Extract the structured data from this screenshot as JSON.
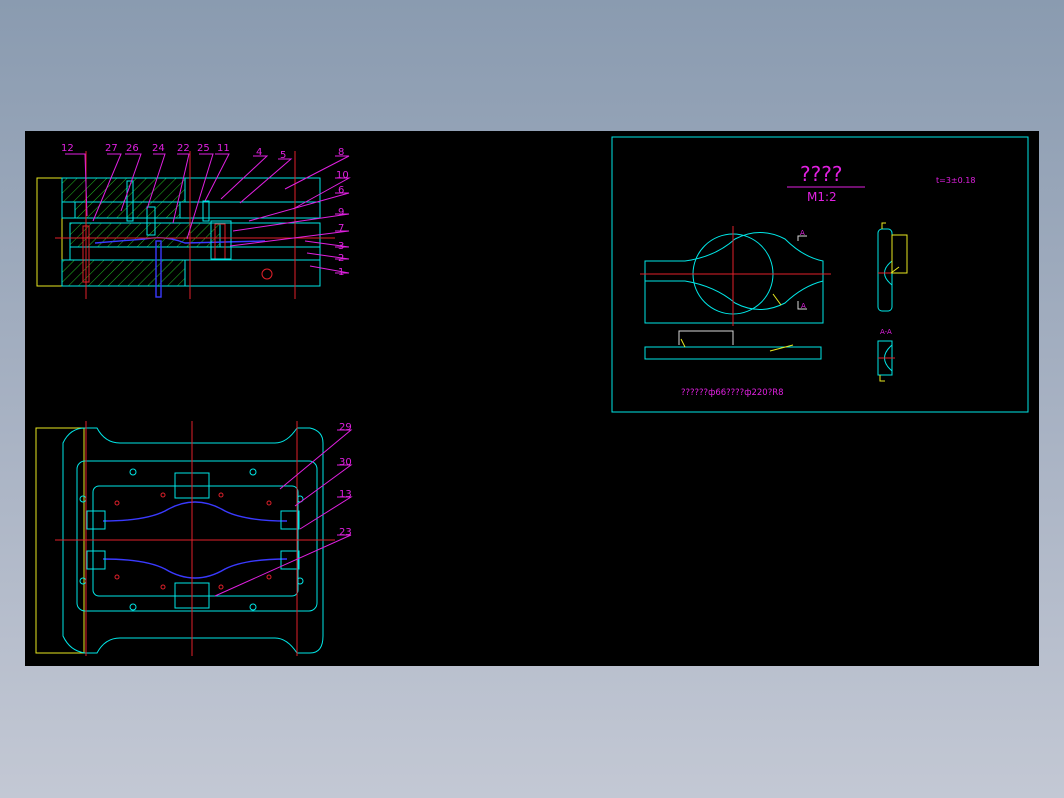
{
  "section_view": {
    "callouts": [
      "12",
      "27",
      "26",
      "24",
      "22",
      "25",
      "11",
      "4",
      "5",
      "8",
      "10",
      "6",
      "9",
      "7",
      "3",
      "2",
      "1"
    ]
  },
  "plan_view": {
    "callouts": [
      "29",
      "30",
      "13",
      "23"
    ]
  },
  "part_drawing": {
    "title": "????",
    "scale": "M1:2",
    "thickness_note": "t=3±0.18",
    "view_marker_a": "A",
    "section_label": "A-A",
    "material_note": "??????ф66????ф220?R8"
  },
  "colors": {
    "background": "#000000",
    "outline": "#00e6e6",
    "centerline": "#e0202a",
    "leader": "#e020e0",
    "highlight": "#e8e820",
    "part": "#3a3aff",
    "hatch": "#22bb22"
  }
}
